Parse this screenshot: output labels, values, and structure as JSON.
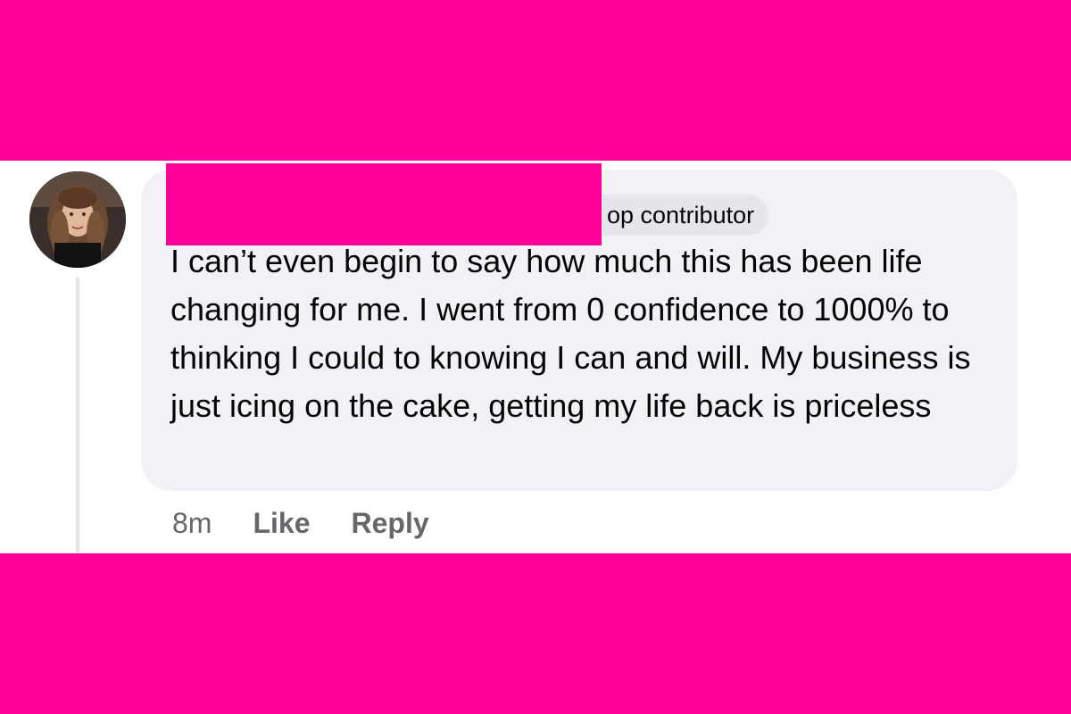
{
  "comment": {
    "badge_label": "op contributor",
    "text": "I can’t even begin to say how much this has been life changing for me. I went from 0 confidence to 1000% to thinking I could to knowing I can and will. My business is just icing on the cake, getting my life back is priceless",
    "time": "8m",
    "like_label": "Like",
    "reply_label": "Reply"
  },
  "colors": {
    "accent_pink": "#ff0099",
    "bubble_bg": "#f0f2f5",
    "badge_bg": "#e4e6eb",
    "text": "#050505",
    "muted": "#65676b"
  },
  "icons": {
    "avatar": "profile-photo"
  }
}
